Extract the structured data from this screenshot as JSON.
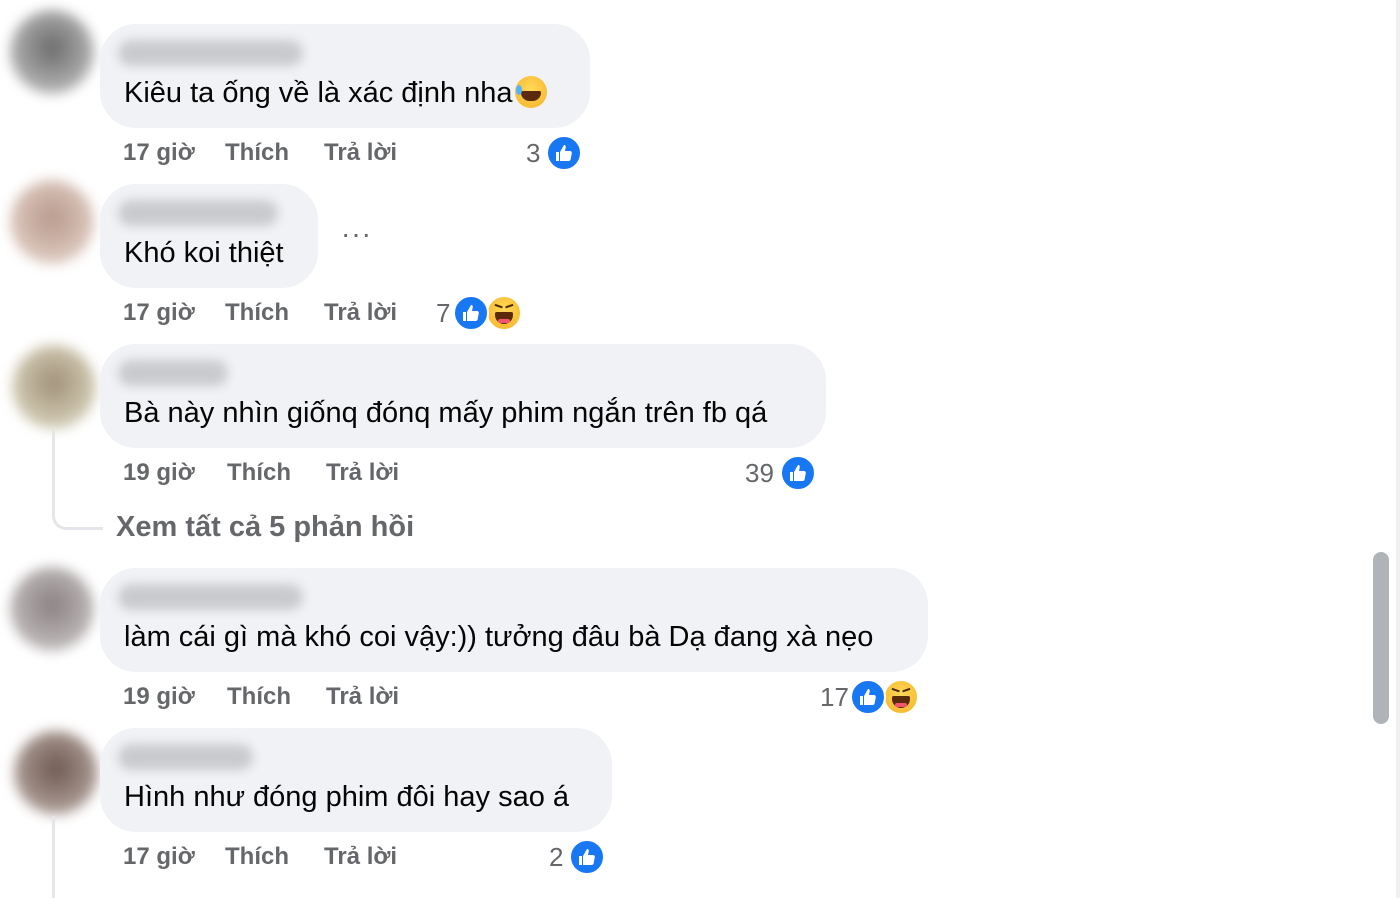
{
  "comments": [
    {
      "text": "Kiêu ta ống về là xác định nha",
      "time": "17 giờ",
      "like_label": "Thích",
      "reply_label": "Trả lời",
      "reaction_count": "3",
      "reactions": [
        "like-icon"
      ],
      "trailing_emoji": "laugh-cry-emoji"
    },
    {
      "text": "Khó koi thiệt",
      "time": "17 giờ",
      "like_label": "Thích",
      "reply_label": "Trả lời",
      "reaction_count": "7",
      "reactions": [
        "like-icon",
        "haha-icon"
      ],
      "more_options": "···"
    },
    {
      "text": "Bà này nhìn giốnq đónq mấy phim ngắn trên fb qá",
      "time": "19 giờ",
      "like_label": "Thích",
      "reply_label": "Trả lời",
      "reaction_count": "39",
      "reactions": [
        "like-icon"
      ],
      "view_replies": "Xem tất cả 5 phản hồi"
    },
    {
      "text": "làm cái gì mà khó coi vậy:)) tưởng đâu bà Dạ đang xà nẹo",
      "time": "19 giờ",
      "like_label": "Thích",
      "reply_label": "Trả lời",
      "reaction_count": "17",
      "reactions": [
        "like-icon",
        "haha-icon"
      ]
    },
    {
      "text": "Hình như đóng phim đôi hay sao á",
      "time": "17 giờ",
      "like_label": "Thích",
      "reply_label": "Trả lời",
      "reaction_count": "2",
      "reactions": [
        "like-icon"
      ]
    }
  ],
  "colors": {
    "bubble_bg": "#f0f2f5",
    "meta_text": "#65676b",
    "like_blue": "#1877f2",
    "haha_yellow": "#f7b125"
  }
}
